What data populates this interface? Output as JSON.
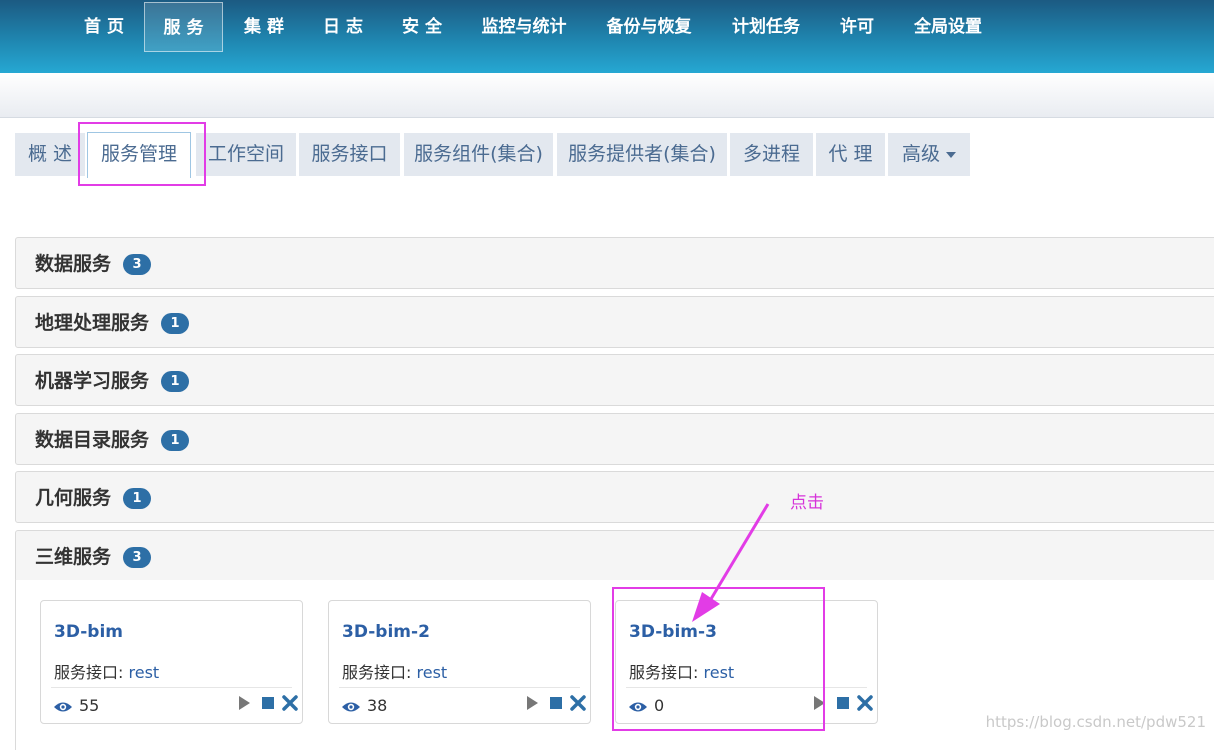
{
  "topnav": {
    "items": [
      {
        "label": "首 页"
      },
      {
        "label": "服 务",
        "active": true
      },
      {
        "label": "集 群"
      },
      {
        "label": "日 志"
      },
      {
        "label": "安 全"
      },
      {
        "label": "监控与统计"
      },
      {
        "label": "备份与恢复"
      },
      {
        "label": "计划任务"
      },
      {
        "label": "许可"
      },
      {
        "label": "全局设置"
      }
    ]
  },
  "tabs": [
    {
      "label": "概 述"
    },
    {
      "label": "服务管理",
      "active": true
    },
    {
      "label": "工作空间"
    },
    {
      "label": "服务接口"
    },
    {
      "label": "服务组件(集合)"
    },
    {
      "label": "服务提供者(集合)"
    },
    {
      "label": "多进程"
    },
    {
      "label": "代 理"
    },
    {
      "label": "高级"
    }
  ],
  "categories": [
    {
      "name": "数据服务",
      "count": "3"
    },
    {
      "name": "地理处理服务",
      "count": "1"
    },
    {
      "name": "机器学习服务",
      "count": "1"
    },
    {
      "name": "数据目录服务",
      "count": "1"
    },
    {
      "name": "几何服务",
      "count": "1"
    },
    {
      "name": "三维服务",
      "count": "3",
      "expanded": true
    }
  ],
  "services": [
    {
      "name": "3D-bim",
      "interface_label": "服务接口:",
      "interface": "rest",
      "views": "55"
    },
    {
      "name": "3D-bim-2",
      "interface_label": "服务接口:",
      "interface": "rest",
      "views": "38"
    },
    {
      "name": "3D-bim-3",
      "interface_label": "服务接口:",
      "interface": "rest",
      "views": "0"
    }
  ],
  "annotation": {
    "text": "点击",
    "color": "#e23ce6"
  },
  "watermark": "https://blog.csdn.net/pdw521",
  "colors": {
    "nav_top": "#1c5a82",
    "nav_bottom": "#26a8d3",
    "badge": "#2d6fa6",
    "link": "#2c5fa5",
    "highlight": "#e23ce6"
  },
  "icons": {
    "views": "eye-icon",
    "start": "play-icon",
    "stop": "stop-icon",
    "delete": "close-icon",
    "dropdown": "caret-down-icon"
  }
}
